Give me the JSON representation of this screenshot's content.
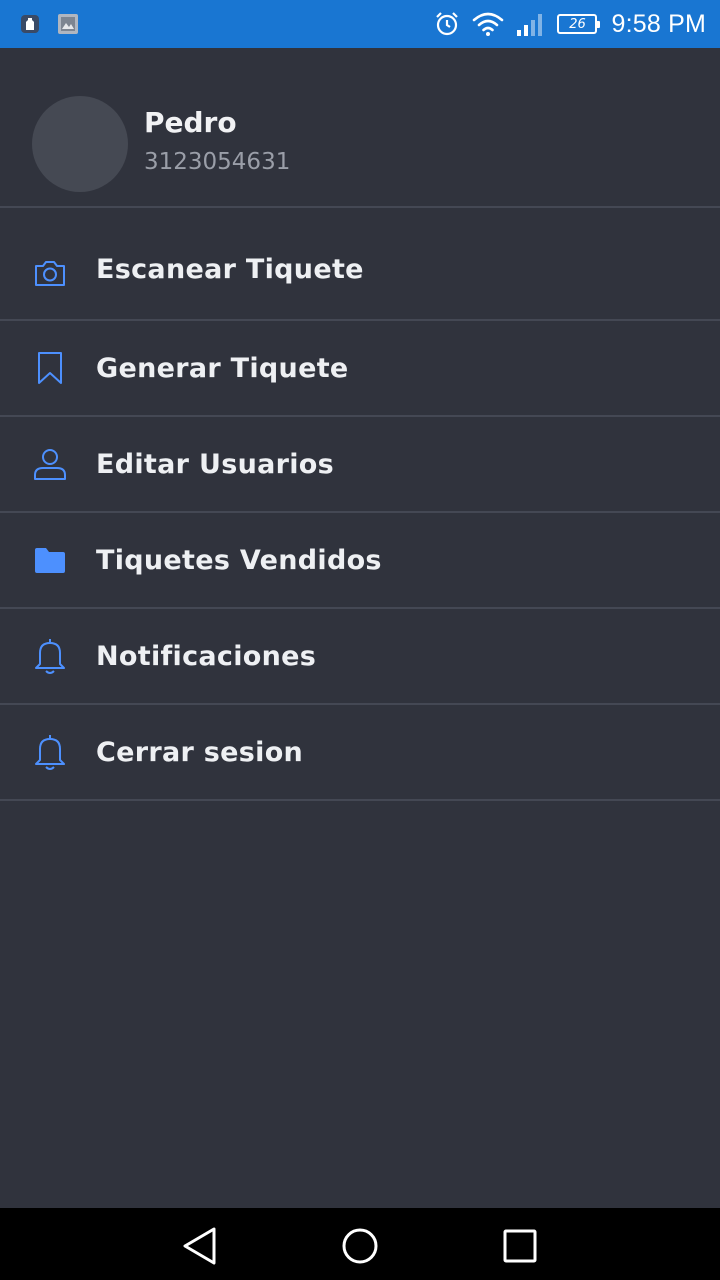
{
  "status_bar": {
    "left_icons": [
      "notification-app-icon",
      "image-icon"
    ],
    "right_icons": [
      "alarm-icon",
      "wifi-icon",
      "signal-icon"
    ],
    "battery": "26",
    "time": "9:58 PM",
    "background": "#1976d2"
  },
  "drawer": {
    "user": {
      "name": "Pedro",
      "phone": "3123054631"
    },
    "accent_color": "#4d90fe",
    "items": [
      {
        "label": "Escanear Tiquete",
        "icon": "camera-icon"
      },
      {
        "label": "Generar Tiquete",
        "icon": "bookmark-icon"
      },
      {
        "label": "Editar Usuarios",
        "icon": "user-icon"
      },
      {
        "label": "Tiquetes Vendidos",
        "icon": "folder-icon"
      },
      {
        "label": "Notificaciones",
        "icon": "bell-icon"
      },
      {
        "label": "Cerrar sesion",
        "icon": "bell-icon"
      }
    ]
  },
  "nav_bar": {
    "buttons": [
      "back-icon",
      "home-icon",
      "recents-icon"
    ]
  }
}
